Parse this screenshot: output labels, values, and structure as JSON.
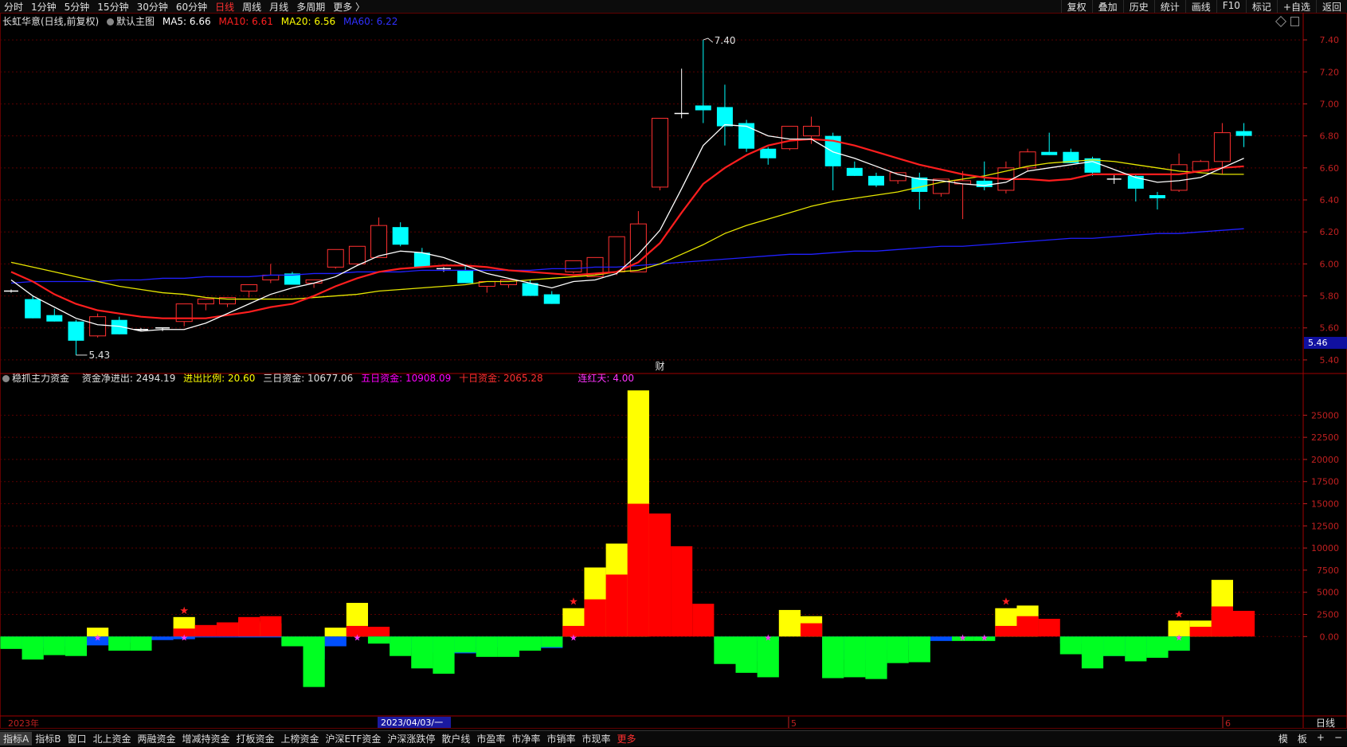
{
  "toolbar": {
    "periods": [
      "分时",
      "1分钟",
      "5分钟",
      "15分钟",
      "30分钟",
      "60分钟",
      "日线",
      "周线",
      "月线",
      "多周期",
      "更多 〉"
    ],
    "active_period": "日线",
    "right_items": [
      "复权",
      "叠加",
      "历史",
      "统计",
      "画线",
      "F10",
      "标记",
      "+自选",
      "返回"
    ]
  },
  "main_header": {
    "stock": "长虹华意(日线,前复权)",
    "template": "默认主图",
    "ma5": "MA5: 6.66",
    "ma10": "MA10: 6.61",
    "ma20": "MA20: 6.56",
    "ma60": "MA60: 6.22"
  },
  "sub_header": {
    "indicator": "稳抓主力资金",
    "net": "资金净进出: 2494.19",
    "ratio": "进出比例: 20.60",
    "three_day": "三日资金: 10677.06",
    "five_day": "五日资金: 10908.09",
    "ten_day": "十日资金: 2065.28",
    "streak": "连红天: 4.00"
  },
  "colors": {
    "up": "#ff3030",
    "down": "#00ffff",
    "ma5": "#ffffff",
    "ma10": "#ff1e1e",
    "ma20": "#e6e600",
    "ma60": "#2020ff",
    "bar_yellow": "#ffff00",
    "bar_red": "#ff0000",
    "bar_blue": "#0050ff",
    "bar_green": "#00ff22",
    "grid": "#5a0000",
    "axis": "#c02020"
  },
  "chart_data": [
    {
      "type": "candlestick",
      "title": "长虹华意(日线,前复权)",
      "y_ticks": [
        5.4,
        5.6,
        5.8,
        6.0,
        6.2,
        6.4,
        6.6,
        6.8,
        7.0,
        7.2,
        7.4
      ],
      "ylim": [
        5.33,
        7.48
      ],
      "current_price": "5.46",
      "annotations": {
        "high": "7.40",
        "low": "5.43",
        "marker": "财"
      },
      "candles": [
        [
          5.83,
          5.84,
          5.82,
          5.83
        ],
        [
          5.78,
          5.8,
          5.66,
          5.66
        ],
        [
          5.68,
          5.72,
          5.64,
          5.64
        ],
        [
          5.64,
          5.65,
          5.43,
          5.52
        ],
        [
          5.55,
          5.69,
          5.54,
          5.67
        ],
        [
          5.65,
          5.67,
          5.56,
          5.56
        ],
        [
          5.59,
          5.6,
          5.58,
          5.59
        ],
        [
          5.6,
          5.6,
          5.58,
          5.59
        ],
        [
          5.64,
          5.75,
          5.61,
          5.75
        ],
        [
          5.75,
          5.78,
          5.71,
          5.78
        ],
        [
          5.75,
          5.79,
          5.73,
          5.79
        ],
        [
          5.83,
          5.87,
          5.79,
          5.87
        ],
        [
          5.9,
          6.0,
          5.88,
          5.93
        ],
        [
          5.94,
          5.95,
          5.87,
          5.87
        ],
        [
          5.88,
          5.9,
          5.85,
          5.9
        ],
        [
          5.98,
          6.09,
          5.97,
          6.09
        ],
        [
          6.0,
          6.11,
          5.99,
          6.11
        ],
        [
          6.04,
          6.29,
          6.04,
          6.24
        ],
        [
          6.23,
          6.26,
          6.11,
          6.12
        ],
        [
          6.07,
          6.1,
          5.98,
          5.98
        ],
        [
          5.97,
          5.98,
          5.95,
          5.96
        ],
        [
          5.96,
          5.99,
          5.88,
          5.88
        ],
        [
          5.86,
          5.89,
          5.82,
          5.89
        ],
        [
          5.87,
          5.9,
          5.85,
          5.9
        ],
        [
          5.88,
          5.9,
          5.8,
          5.8
        ],
        [
          5.81,
          5.83,
          5.75,
          5.75
        ],
        [
          5.95,
          6.02,
          5.94,
          6.02
        ],
        [
          5.92,
          6.04,
          5.92,
          6.04
        ],
        [
          5.95,
          6.17,
          5.93,
          6.17
        ],
        [
          5.95,
          6.33,
          5.95,
          6.25
        ],
        [
          6.48,
          6.91,
          6.46,
          6.91
        ],
        [
          6.94,
          7.22,
          6.91,
          6.94
        ],
        [
          6.99,
          7.4,
          6.88,
          6.96
        ],
        [
          6.98,
          7.12,
          6.74,
          6.86
        ],
        [
          6.88,
          6.9,
          6.7,
          6.72
        ],
        [
          6.72,
          6.73,
          6.62,
          6.66
        ],
        [
          6.72,
          6.86,
          6.71,
          6.86
        ],
        [
          6.8,
          6.92,
          6.75,
          6.86
        ],
        [
          6.8,
          6.82,
          6.46,
          6.61
        ],
        [
          6.6,
          6.64,
          6.55,
          6.55
        ],
        [
          6.55,
          6.57,
          6.48,
          6.49
        ],
        [
          6.52,
          6.57,
          6.5,
          6.57
        ],
        [
          6.54,
          6.57,
          6.34,
          6.45
        ],
        [
          6.44,
          6.53,
          6.42,
          6.53
        ],
        [
          6.5,
          6.58,
          6.28,
          6.52
        ],
        [
          6.52,
          6.64,
          6.46,
          6.48
        ],
        [
          6.46,
          6.64,
          6.44,
          6.6
        ],
        [
          6.6,
          6.72,
          6.58,
          6.7
        ],
        [
          6.7,
          6.82,
          6.68,
          6.68
        ],
        [
          6.7,
          6.72,
          6.63,
          6.63
        ],
        [
          6.66,
          6.67,
          6.55,
          6.57
        ],
        [
          6.53,
          6.56,
          6.5,
          6.53
        ],
        [
          6.55,
          6.56,
          6.39,
          6.47
        ],
        [
          6.43,
          6.45,
          6.34,
          6.41
        ],
        [
          6.46,
          6.69,
          6.45,
          6.62
        ],
        [
          6.58,
          6.65,
          6.58,
          6.64
        ],
        [
          6.64,
          6.88,
          6.56,
          6.82
        ],
        [
          6.83,
          6.88,
          6.73,
          6.8
        ]
      ],
      "ma5": [
        5.9,
        5.8,
        5.73,
        5.66,
        5.62,
        5.61,
        5.58,
        5.59,
        5.59,
        5.63,
        5.69,
        5.75,
        5.81,
        5.85,
        5.88,
        5.92,
        5.99,
        6.05,
        6.08,
        6.07,
        6.04,
        5.99,
        5.94,
        5.91,
        5.88,
        5.85,
        5.89,
        5.9,
        5.94,
        6.06,
        6.21,
        6.47,
        6.74,
        6.87,
        6.86,
        6.8,
        6.78,
        6.78,
        6.7,
        6.66,
        6.61,
        6.56,
        6.53,
        6.52,
        6.5,
        6.49,
        6.51,
        6.58,
        6.6,
        6.62,
        6.64,
        6.59,
        6.54,
        6.51,
        6.52,
        6.54,
        6.6,
        6.66
      ],
      "ma10": [
        5.95,
        5.89,
        5.81,
        5.75,
        5.71,
        5.69,
        5.67,
        5.66,
        5.66,
        5.66,
        5.68,
        5.7,
        5.73,
        5.75,
        5.8,
        5.86,
        5.91,
        5.95,
        5.97,
        5.98,
        5.99,
        5.99,
        5.98,
        5.96,
        5.95,
        5.94,
        5.93,
        5.94,
        5.95,
        6.01,
        6.13,
        6.32,
        6.5,
        6.6,
        6.68,
        6.74,
        6.77,
        6.78,
        6.77,
        6.74,
        6.7,
        6.66,
        6.62,
        6.59,
        6.56,
        6.54,
        6.53,
        6.53,
        6.52,
        6.53,
        6.56,
        6.56,
        6.56,
        6.56,
        6.56,
        6.58,
        6.6,
        6.61
      ],
      "ma20": [
        6.01,
        5.98,
        5.95,
        5.92,
        5.89,
        5.86,
        5.84,
        5.82,
        5.81,
        5.79,
        5.78,
        5.78,
        5.78,
        5.78,
        5.79,
        5.8,
        5.81,
        5.83,
        5.84,
        5.85,
        5.86,
        5.87,
        5.89,
        5.89,
        5.9,
        5.91,
        5.92,
        5.93,
        5.95,
        5.96,
        6.0,
        6.06,
        6.12,
        6.19,
        6.24,
        6.28,
        6.32,
        6.36,
        6.39,
        6.41,
        6.43,
        6.45,
        6.48,
        6.51,
        6.53,
        6.55,
        6.58,
        6.61,
        6.63,
        6.64,
        6.65,
        6.64,
        6.62,
        6.6,
        6.58,
        6.57,
        6.56,
        6.56
      ],
      "ma60": [
        5.88,
        5.89,
        5.89,
        5.89,
        5.89,
        5.9,
        5.9,
        5.91,
        5.91,
        5.92,
        5.92,
        5.92,
        5.93,
        5.93,
        5.94,
        5.94,
        5.95,
        5.95,
        5.95,
        5.96,
        5.96,
        5.96,
        5.96,
        5.96,
        5.96,
        5.97,
        5.97,
        5.98,
        5.98,
        5.99,
        6.0,
        6.01,
        6.02,
        6.03,
        6.04,
        6.05,
        6.06,
        6.06,
        6.07,
        6.08,
        6.08,
        6.09,
        6.1,
        6.11,
        6.11,
        6.12,
        6.13,
        6.14,
        6.15,
        6.16,
        6.16,
        6.17,
        6.18,
        6.19,
        6.19,
        6.2,
        6.21,
        6.22
      ]
    },
    {
      "type": "bar",
      "title": "稳抓主力资金",
      "y_ticks": [
        0,
        2500,
        5000,
        7500,
        10000,
        12500,
        15000,
        17500,
        20000,
        22500,
        25000
      ],
      "y_tick_labels": [
        "0.00",
        "2500",
        "5000",
        "7500",
        "10000",
        "12500",
        "15000",
        "17500",
        "20000",
        "22500",
        "25000"
      ],
      "ylim": [
        -8700,
        28000
      ],
      "series": [
        {
          "color": "yellow",
          "values": [
            0,
            0,
            0,
            0,
            1000,
            0,
            0,
            0,
            2200,
            0,
            0,
            1700,
            1500,
            0,
            0,
            1000,
            3800,
            0,
            0,
            0,
            0,
            0,
            0,
            0,
            0,
            0,
            3200,
            7800,
            10500,
            27800,
            0,
            0,
            0,
            0,
            0,
            0,
            3000,
            2300,
            0,
            0,
            0,
            0,
            0,
            0,
            0,
            0,
            3200,
            3500,
            0,
            0,
            0,
            0,
            0,
            0,
            1800,
            1800,
            6400,
            0
          ]
        },
        {
          "color": "red",
          "values": [
            0,
            0,
            0,
            0,
            0,
            0,
            0,
            0,
            900,
            1300,
            1600,
            2200,
            2300,
            0,
            0,
            0,
            1200,
            1100,
            0,
            0,
            0,
            0,
            0,
            0,
            0,
            0,
            1200,
            4200,
            7000,
            15000,
            13900,
            10200,
            3700,
            0,
            0,
            0,
            0,
            1500,
            0,
            0,
            0,
            0,
            0,
            0,
            0,
            0,
            1200,
            2300,
            2000,
            0,
            0,
            0,
            0,
            0,
            0,
            1100,
            3400,
            2900
          ]
        },
        {
          "color": "blue",
          "values": [
            -1200,
            -1300,
            -1100,
            -1100,
            -1000,
            -700,
            -500,
            -400,
            -300,
            -100,
            -100,
            -100,
            -100,
            -1000,
            -2600,
            -1100,
            0,
            -700,
            -1300,
            -1800,
            -2000,
            -1900,
            -1200,
            -1100,
            -1200,
            -1300,
            0,
            0,
            0,
            0,
            0,
            0,
            0,
            -700,
            -2800,
            -500,
            0,
            0,
            -1500,
            -2600,
            -3500,
            -1500,
            -1000,
            -500,
            -300,
            -100,
            0,
            0,
            0,
            -800,
            -2200,
            -2200,
            -2000,
            -1900,
            -1600,
            0,
            0,
            0
          ]
        },
        {
          "color": "green",
          "values": [
            -1400,
            -2600,
            -2100,
            -2200,
            0,
            -1600,
            -1600,
            0,
            0,
            0,
            0,
            0,
            0,
            -1100,
            -5700,
            0,
            0,
            -800,
            -2200,
            -3600,
            -4200,
            -1800,
            -2300,
            -2300,
            -1600,
            -1200,
            0,
            0,
            0,
            0,
            0,
            0,
            0,
            -3100,
            -4100,
            -4600,
            0,
            0,
            -4700,
            -4600,
            -4800,
            -3000,
            -2900,
            0,
            -500,
            -500,
            0,
            0,
            0,
            -2000,
            -3600,
            -2200,
            -2800,
            -2400,
            -1600,
            0,
            0,
            0
          ]
        }
      ],
      "markers": {
        "red_star_days": [
          8,
          26,
          46,
          54
        ],
        "magenta_star_days": [
          4,
          8,
          16,
          26,
          35,
          44,
          45,
          54
        ]
      }
    }
  ],
  "time_axis": {
    "labels": [
      "2023年",
      "2023/04/03/一",
      "5",
      "6"
    ],
    "period": "日线"
  },
  "bottom_tabs": {
    "items": [
      "指标A",
      "指标B",
      "窗口",
      "北上资金",
      "两融资金",
      "增减持资金",
      "打板资金",
      "上榜资金",
      "沪深ETF资金",
      "沪深涨跌停",
      "散户线",
      "市盈率",
      "市净率",
      "市销率",
      "市现率",
      "更多"
    ],
    "right": [
      "模",
      "板",
      "+",
      "−"
    ]
  }
}
